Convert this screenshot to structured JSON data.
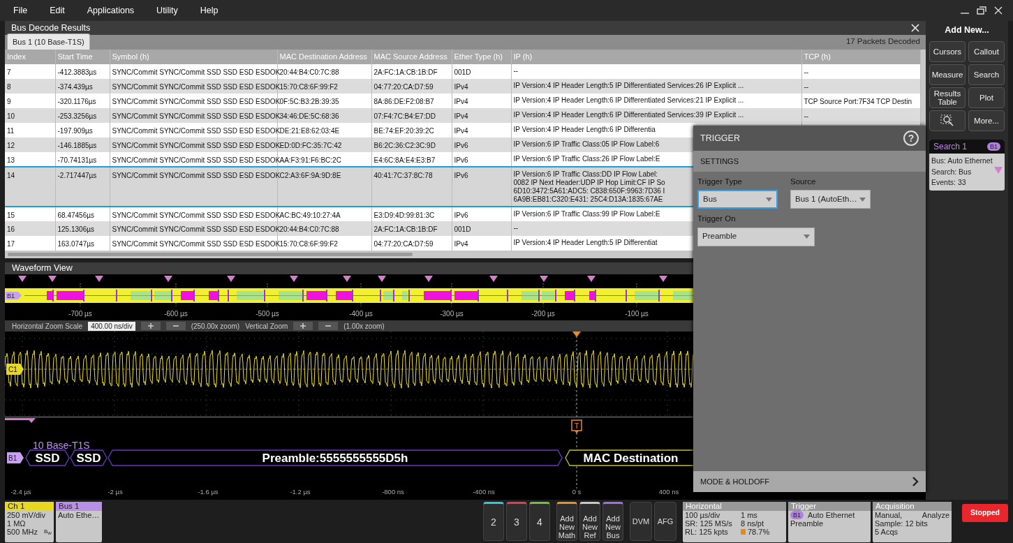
{
  "menu": [
    "File",
    "Edit",
    "Applications",
    "Utility",
    "Help"
  ],
  "results": {
    "title": "Bus Decode Results",
    "tab": {
      "label": "Bus 1 (10 Base-T1S)",
      "selected": true
    },
    "summary": "17 Packets Decoded",
    "columns": [
      "Index",
      "Start Time",
      "Symbol (h)",
      "MAC Destination Address",
      "MAC Source Address",
      "Ether Type (h)",
      "IP (h)",
      "TCP (h)"
    ],
    "rows": [
      {
        "cells": [
          "7",
          "-412.3883µs",
          "SYNC/Commit SYNC/Commit SSD SSD ESD ESDOK",
          "20:44:B4:C0:7C:88",
          "2A:FC:1A:CB:1B:DF",
          "001D"
        ],
        "ip": [
          "--"
        ],
        "tcp": "--",
        "selected": false
      },
      {
        "cells": [
          "8",
          "-374.439µs",
          "SYNC/Commit SYNC/Commit SSD SSD ESD ESDOK",
          "15:70:C8:6F:99:F2",
          "04:77:20:CA:D7:59",
          "IPv4"
        ],
        "ip": [
          "IP Version:4 IP Header Length:5 IP Differentiated Services:26 IP Explicit ..."
        ],
        "tcp": "--",
        "selected": false
      },
      {
        "cells": [
          "9",
          "-320.1176µs",
          "SYNC/Commit SYNC/Commit SSD SSD ESD ESDOK",
          "0F:5C:B3:2B:39:35",
          "8A:86:DE:F2:08:B7",
          "IPv4"
        ],
        "ip": [
          "IP Version:4 IP Header Length:6 IP Differentiated Services:21 IP Explicit ..."
        ],
        "tcp": "TCP Source Port:7F34 TCP Destin",
        "selected": false
      },
      {
        "cells": [
          "10",
          "-253.3256µs",
          "SYNC/Commit SYNC/Commit SSD SSD ESD ESDOK",
          "34:46:DE:5C:68:36",
          "07:F4:7C:B4:E7:DD",
          "IPv4"
        ],
        "ip": [
          "IP Version:4 IP Header Length:6 IP Differentiated Services:39 IP Explicit ..."
        ],
        "tcp": "--",
        "selected": false
      },
      {
        "cells": [
          "11",
          "-197.909µs",
          "SYNC/Commit SYNC/Commit SSD SSD ESD ESDOK",
          "DE:21:E8:62:03:4E",
          "BE:74:EF:20:39:2C",
          "IPv4"
        ],
        "ip": [
          "IP Version:4 IP Header Length:6 IP Differentia"
        ],
        "selected": false
      },
      {
        "cells": [
          "12",
          "-146.1885µs",
          "SYNC/Commit SYNC/Commit SSD SSD ESD ESDOK",
          "ED:0D:FC:35:7C:42",
          "B6:2C:36:C2:3C:9D",
          "IPv6"
        ],
        "ip": [
          "IP Version:6 IP Traffic Class:05 IP Flow Label:6"
        ],
        "selected": false
      },
      {
        "cells": [
          "13",
          "-70.74131µs",
          "SYNC/Commit SYNC/Commit SSD SSD ESD ESDOK",
          "AA:F3:91:F6:BC:2C",
          "E4:6C:8A:E4:E3:B7",
          "IPv6"
        ],
        "ip": [
          "IP Version:6 IP Traffic Class:26 IP Flow Label:E"
        ],
        "selected": false
      },
      {
        "cells": [
          "14",
          "-2.717447µs",
          "SYNC/Commit SYNC/Commit SSD SSD ESD ESDOK",
          "C2:A3:6F:9A:9D:8E",
          "40:41:7C:37:8C:78",
          "IPv6"
        ],
        "ip": [
          "IP Version:6 IP Traffic Class:DD IP Flow Label:",
          "0082 IP Next Header:UDP IP Hop Limit:CF IP So",
          "6D10:3472:5A61:ADC5: C838:650F:9963:7D36 I",
          "6A9B:EB81:C320:E431: 25C4:D13A:1835:67AE"
        ],
        "selected": true
      },
      {
        "cells": [
          "15",
          "68.47456µs",
          "SYNC/Commit SYNC/Commit SSD SSD ESD ESDOK",
          "AC:BC:49:10:27:4A",
          "E3:D9:4D:99:81:3C",
          "IPv6"
        ],
        "ip": [
          "IP Version:6 IP Traffic Class:99 IP Flow Label:E"
        ],
        "selected": false
      },
      {
        "cells": [
          "16",
          "125.1306µs",
          "SYNC/Commit SYNC/Commit SSD SSD ESD ESDOK",
          "20:44:B4:C0:7C:88",
          "2A:FC:1A:CB:1B:DF",
          "001D"
        ],
        "ip": [
          "--"
        ],
        "selected": false
      },
      {
        "cells": [
          "17",
          "163.0747µs",
          "SYNC/Commit SYNC/Commit SSD SSD ESD ESDOK",
          "15:70:C8:6F:99:F2",
          "04:77:20:CA:D7:59",
          "IPv4"
        ],
        "ip": [
          "IP Version:4 IP Header Length:5 IP Differentiat"
        ],
        "selected": false
      }
    ]
  },
  "waveform": {
    "title": "Waveform View",
    "overview_badge": "B1",
    "overview_ticks": [
      "-700 µs",
      "-600 µs",
      "-500 µs",
      "-400 µs",
      "-300 µs",
      "-200 µs",
      "-100 µs"
    ],
    "zoom": {
      "h_label": "Horizontal Zoom Scale",
      "h_value": "400.00 ns/div",
      "h_factor": "(250.00x zoom)",
      "v_label": "Vertical Zoom",
      "v_factor": "(1.00x zoom)"
    },
    "channel_badge": "C1",
    "trigger_mark": "T",
    "bus_badge": "B1",
    "bus_name": "10 Base-T1S",
    "segments": [
      {
        "text": "SSD",
        "kind": "symbol"
      },
      {
        "text": "SSD",
        "kind": "symbol"
      },
      {
        "text": "Preamble:5555555555D5h",
        "kind": "symbol"
      },
      {
        "text": "MAC Destination",
        "kind": "field"
      }
    ],
    "time_ticks": [
      "-2.4 µs",
      "-2 µs",
      "-1.6 µs",
      "-1.2 µs",
      "-800 ns",
      "-400 ns",
      "0 s",
      "400 ns"
    ]
  },
  "trigger": {
    "title": "TRIGGER",
    "help": "?",
    "section": "SETTINGS",
    "fields": [
      {
        "label": "Trigger Type",
        "value": "Bus",
        "focused": true
      },
      {
        "label": "Source",
        "value": "Bus 1 (AutoEth…",
        "focused": false
      },
      {
        "label": "Trigger On",
        "value": "Preamble",
        "focused": false
      }
    ],
    "footer": "MODE & HOLDOFF"
  },
  "sidebar": {
    "title": "Add New...",
    "buttons": [
      {
        "kind": "text",
        "label": "Cursors"
      },
      {
        "kind": "text",
        "label": "Callout"
      },
      {
        "kind": "text",
        "label": "Measure"
      },
      {
        "kind": "text",
        "label": "Search"
      },
      {
        "kind": "text",
        "label": "Results Table"
      },
      {
        "kind": "text",
        "label": "Plot"
      },
      {
        "kind": "icon"
      },
      {
        "kind": "text",
        "label": "More..."
      }
    ],
    "search": {
      "title": "Search 1",
      "badge": "B1",
      "lines": [
        "Bus: Auto Ethernet",
        "Search: Bus",
        "Events: 33"
      ]
    }
  },
  "bottom": {
    "channel": {
      "name": "Ch 1",
      "lines": [
        "250 mV/div",
        "1 MΩ",
        "500 MHz"
      ],
      "bw": "B$_{W}$"
    },
    "bus": {
      "name": "Bus 1",
      "lines": [
        "Auto Ethe…"
      ]
    },
    "channel_buttons": [
      {
        "label": "2",
        "color": "#2ec8d8"
      },
      {
        "label": "3",
        "color": "#e0404c"
      },
      {
        "label": "4",
        "color": "#70c040"
      }
    ],
    "add_buttons": [
      {
        "label": "Add New Math",
        "color": "#e8902a"
      },
      {
        "label": "Add New Ref",
        "color": "#c8c8c8"
      },
      {
        "label": "Add New Bus",
        "color": "#a070e0"
      }
    ],
    "tools": [
      "DVM",
      "AFG"
    ],
    "horizontal": {
      "title": "Horizontal",
      "cells": [
        "100 µs/div",
        "1 ms",
        "SR: 125 MS/s",
        "8 ns/pt",
        "RL: 125 kpts",
        "78.7%"
      ]
    },
    "trigger": {
      "title": "Trigger",
      "badge": "B1",
      "source": "Auto Ethernet",
      "type": "Preamble"
    },
    "acquisition": {
      "title": "Acquisition",
      "lines": [
        [
          "Manual,",
          "Analyze"
        ],
        [
          "Sample: 12 bits"
        ],
        [
          "5 Acqs"
        ]
      ]
    },
    "run_state": {
      "label": "Stopped",
      "running": false
    }
  }
}
